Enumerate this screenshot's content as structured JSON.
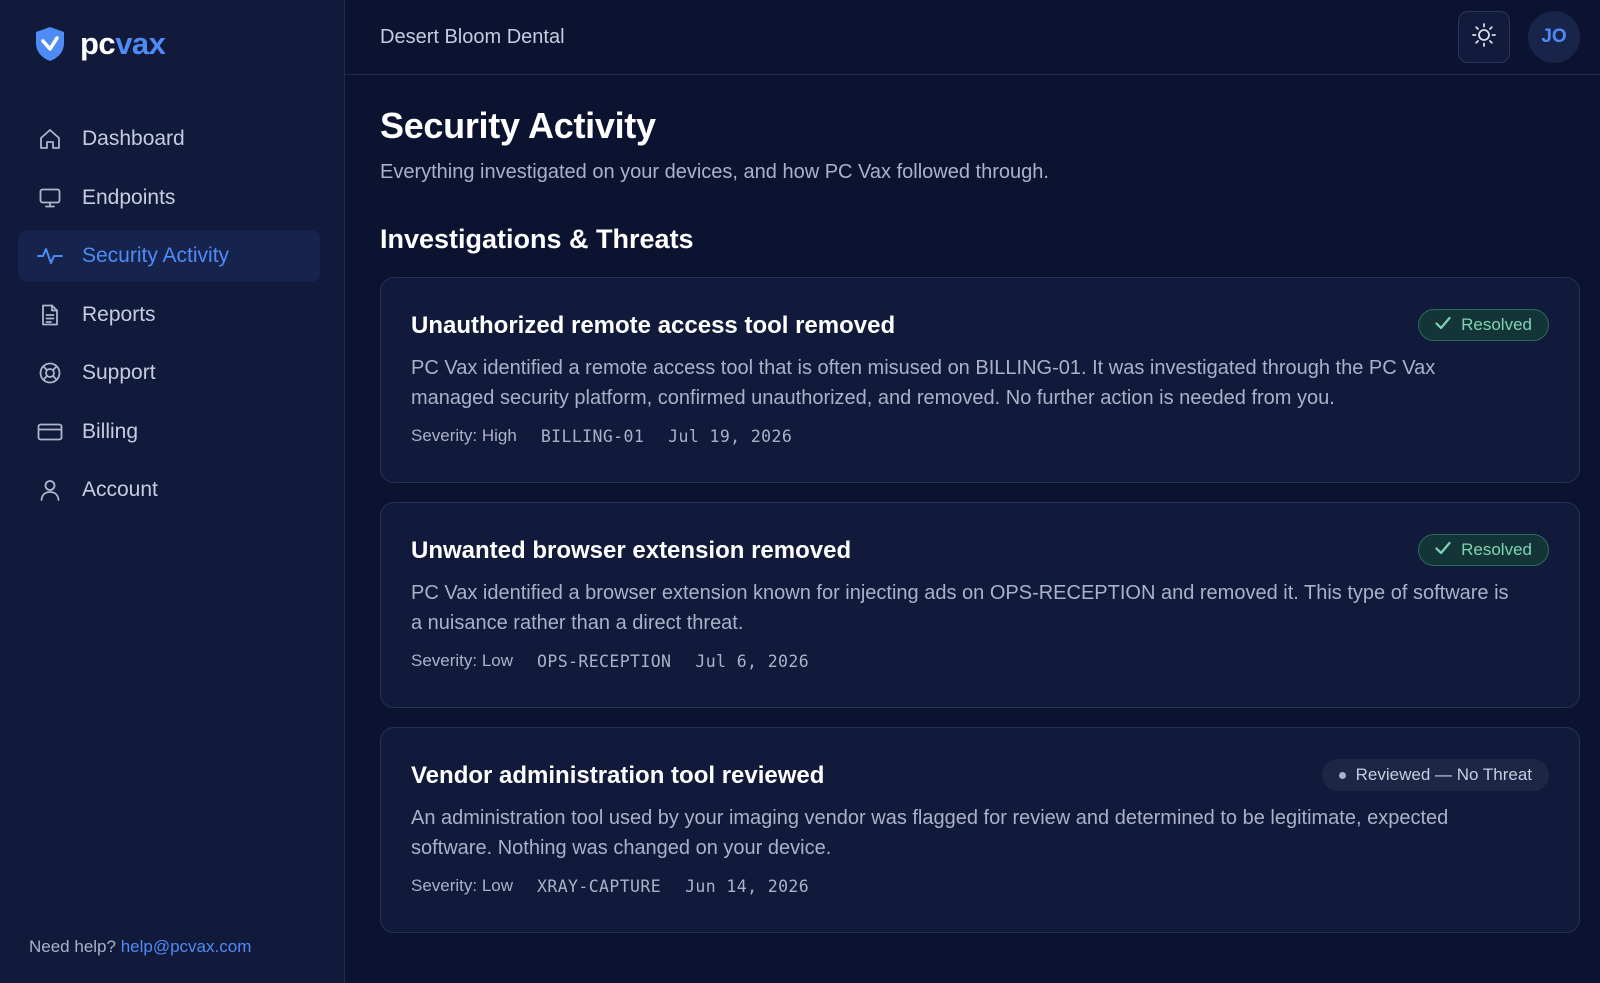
{
  "brand": {
    "name_part1": "pc",
    "name_part2": "vax",
    "accent_color": "#4f8bf5"
  },
  "sidebar": {
    "items": [
      {
        "label": "Dashboard",
        "icon": "home-icon",
        "active": false
      },
      {
        "label": "Endpoints",
        "icon": "monitor-icon",
        "active": false
      },
      {
        "label": "Security Activity",
        "icon": "activity-icon",
        "active": true
      },
      {
        "label": "Reports",
        "icon": "document-icon",
        "active": false
      },
      {
        "label": "Support",
        "icon": "lifebuoy-icon",
        "active": false
      },
      {
        "label": "Billing",
        "icon": "credit-card-icon",
        "active": false
      },
      {
        "label": "Account",
        "icon": "user-icon",
        "active": false
      }
    ],
    "help_text": "Need help?",
    "help_email": "help@pcvax.com"
  },
  "header": {
    "org_name": "Desert Bloom Dental",
    "avatar_initials": "JO",
    "theme_toggle_icon": "sun-icon"
  },
  "main": {
    "title": "Security Activity",
    "subtitle": "Everything investigated on your devices, and how PC Vax followed through.",
    "section_title": "Investigations & Threats",
    "cards": [
      {
        "title": "Unauthorized remote access tool removed",
        "status": "Resolved",
        "description": "PC Vax identified a remote access tool that is often misused on BILLING-01. It was investigated through the PC Vax managed security platform, confirmed unauthorized, and removed. No further action is needed from you.",
        "severity": "Severity: High",
        "device": "BILLING-01",
        "date": "Jul 19, 2026"
      },
      {
        "title": "Unwanted browser extension removed",
        "status": "Resolved",
        "description": "PC Vax identified a browser extension known for injecting ads on OPS-RECEPTION and removed it. This type of software is a nuisance rather than a direct threat.",
        "severity": "Severity: Low",
        "device": "OPS-RECEPTION",
        "date": "Jul 6, 2026"
      },
      {
        "title": "Vendor administration tool reviewed",
        "status": "Reviewed — No Threat",
        "description": "An administration tool used by your imaging vendor was flagged for review and determined to be legitimate, expected software. Nothing was changed on your device.",
        "severity": "Severity: Low",
        "device": "XRAY-CAPTURE",
        "date": "Jun 14, 2026"
      }
    ]
  }
}
